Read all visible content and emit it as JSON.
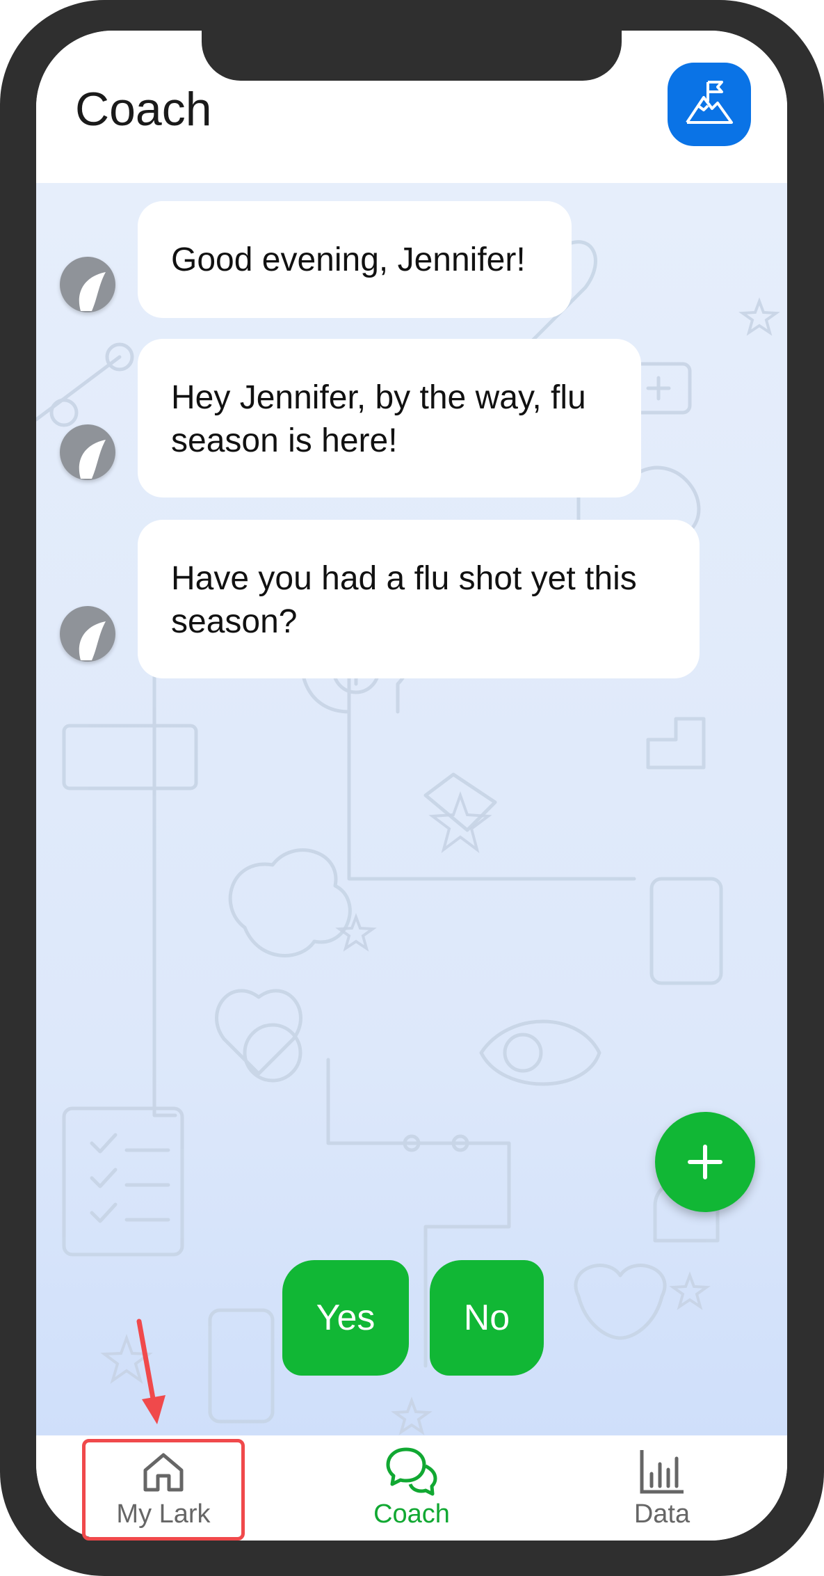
{
  "header": {
    "title": "Coach",
    "goal_button_icon": "mountain-flag-icon"
  },
  "messages": [
    {
      "text": "Good evening, Jennifer!"
    },
    {
      "text": "Hey Jennifer, by the way, flu season is here!"
    },
    {
      "text": "Have you had a flu shot yet this season?"
    }
  ],
  "quick_replies": {
    "yes": "Yes",
    "no": "No"
  },
  "fab": {
    "icon": "plus-icon"
  },
  "tabbar": {
    "tabs": [
      {
        "label": "My Lark",
        "icon": "home-icon"
      },
      {
        "label": "Coach",
        "icon": "chat-bubbles-icon",
        "active": true
      },
      {
        "label": "Data",
        "icon": "bar-chart-icon"
      }
    ]
  },
  "colors": {
    "accent_green": "#11b735",
    "brand_blue": "#0a73e6",
    "annotation_red": "#f0494b"
  }
}
